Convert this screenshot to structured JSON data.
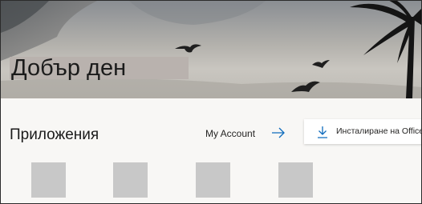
{
  "hero": {
    "greeting": "Добър ден"
  },
  "apps": {
    "title": "Приложения",
    "my_account_label": "My Account",
    "install_label": "Инсталиране на Office",
    "arrow_icon": "arrow-right-icon",
    "download_icon": "download-icon",
    "tiles": [
      "app-tile",
      "app-tile",
      "app-tile",
      "app-tile"
    ]
  },
  "colors": {
    "accent": "#0f6cbd",
    "tile_placeholder": "#c8c8c8",
    "page_background": "#f8f7f5"
  }
}
